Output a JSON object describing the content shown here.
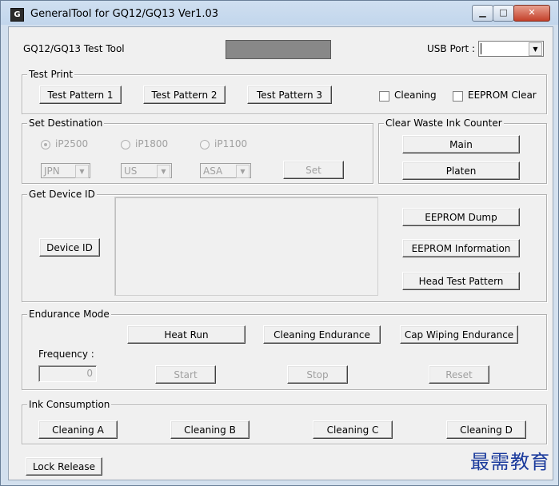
{
  "window": {
    "title": "GeneralTool for GQ12/GQ13 Ver1.03",
    "icon": "app-icon",
    "min_glyph": "▁",
    "max_glyph": "□",
    "close_glyph": "✕"
  },
  "header": {
    "tool_label": "GQ12/GQ13 Test Tool",
    "usb_label": "USB Port :",
    "usb_value": "",
    "status_box_color": "#888888"
  },
  "test_print": {
    "title": "Test Print",
    "btn1": "Test Pattern 1",
    "btn2": "Test Pattern 2",
    "btn3": "Test Pattern 3",
    "cleaning": "Cleaning",
    "eeprom_clear": "EEPROM Clear"
  },
  "set_destination": {
    "title": "Set Destination",
    "radio1": "iP2500",
    "radio2": "iP1800",
    "radio3": "iP1100",
    "combo1": "JPN",
    "combo2": "US",
    "combo3": "ASA",
    "set_btn": "Set"
  },
  "clear_waste": {
    "title": "Clear Waste Ink Counter",
    "main_btn": "Main",
    "platen_btn": "Platen"
  },
  "device_id": {
    "title": "Get Device ID",
    "device_id_btn": "Device ID",
    "eeprom_dump": "EEPROM Dump",
    "eeprom_info": "EEPROM Information",
    "head_test": "Head Test Pattern"
  },
  "endurance": {
    "title": "Endurance Mode",
    "heat_run": "Heat Run",
    "cleaning_endurance": "Cleaning Endurance",
    "cap_wiping": "Cap Wiping Endurance",
    "frequency_label": "Frequency :",
    "frequency_value": "0",
    "start": "Start",
    "stop": "Stop",
    "reset": "Reset"
  },
  "ink": {
    "title": "Ink Consumption",
    "a": "Cleaning A",
    "b": "Cleaning B",
    "c": "Cleaning C",
    "d": "Cleaning D"
  },
  "lock_release": "Lock Release",
  "watermark": "最需教育"
}
